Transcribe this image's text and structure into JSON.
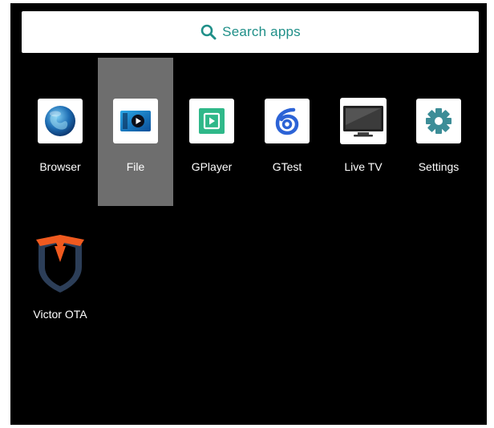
{
  "search": {
    "placeholder": "Search apps",
    "accent_color": "#1f8f88",
    "icon": "search-icon"
  },
  "apps": [
    {
      "label": "Browser",
      "icon": "globe-icon",
      "focused": false
    },
    {
      "label": "File",
      "icon": "file-video-icon",
      "focused": true
    },
    {
      "label": "GPlayer",
      "icon": "play-icon",
      "focused": false
    },
    {
      "label": "GTest",
      "icon": "gtest-icon",
      "focused": false
    },
    {
      "label": "Live TV",
      "icon": "tv-icon",
      "focused": false
    },
    {
      "label": "Settings",
      "icon": "gear-icon",
      "focused": false
    },
    {
      "label": "Victor OTA",
      "icon": "shield-icon",
      "focused": false
    }
  ],
  "colors": {
    "background": "#000000",
    "focus_highlight": "#6e6e6e",
    "label": "#ffffff",
    "gplayer_green": "#2fb889",
    "gtest_blue": "#2c63d6",
    "settings_teal": "#3c8d97",
    "victor_orange": "#f05a1f",
    "victor_navy": "#2c3e58"
  }
}
